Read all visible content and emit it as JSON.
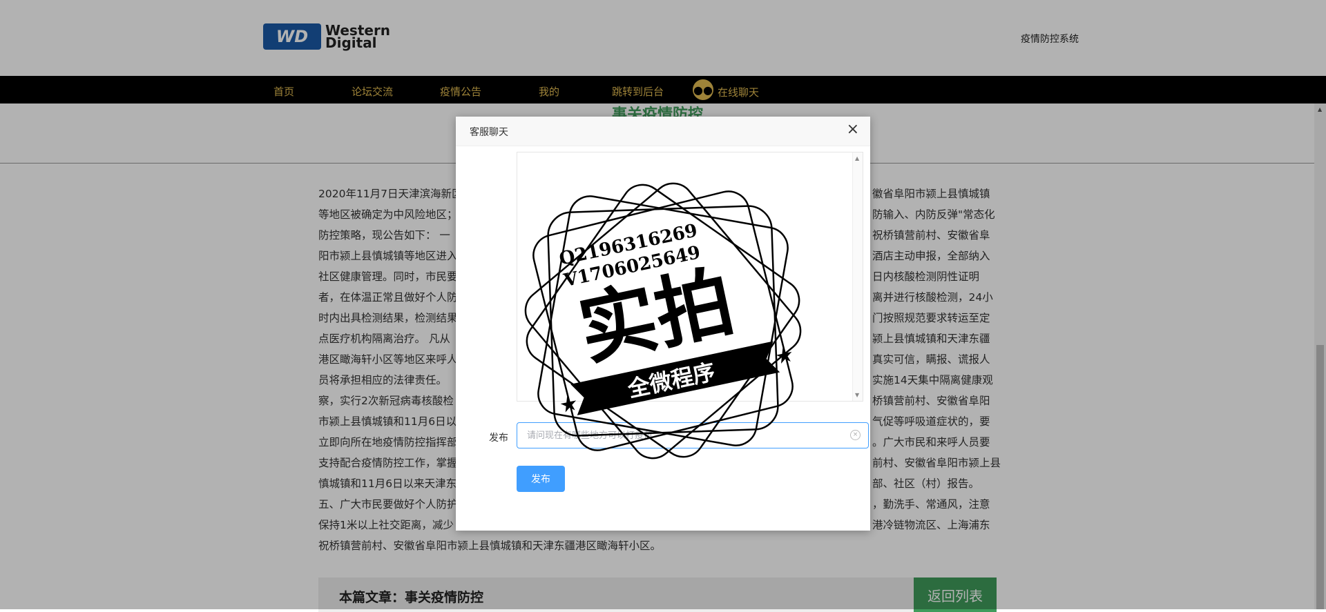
{
  "header": {
    "logo_badge": "WD",
    "logo_line1": "Western",
    "logo_line2": "Digital",
    "system_link": "疫情防控系统"
  },
  "nav": {
    "items": [
      {
        "label": "首页"
      },
      {
        "label": "论坛交流"
      },
      {
        "label": "疫情公告"
      },
      {
        "label": "我的"
      },
      {
        "label": "跳转到后台"
      }
    ],
    "chat_label": "在线聊天"
  },
  "page": {
    "title": "事关疫情防控",
    "article_lines": [
      "2020年11月7日天津滨海新区",
      "等地区被确定为中风险地区；",
      "防控策略，现公告如下： 一",
      "阳市颍上县慎城镇等地区进入",
      "社区健康管理。同时，市民要",
      "者，在体温正常且做好个人防",
      "时内出具检测结果，检测结果",
      "点医疗机构隔离治疗。 凡从",
      "港区瞰海轩小区等地区来呼人",
      "员将承担相应的法律责任。",
      "察，实行2次新冠病毒核酸检",
      "市颍上县慎城镇和11月6日以",
      "立即向所在地疫情防控指挥部",
      "支持配合疫情防控工作，掌握",
      "慎城镇和11月6日以来天津东",
      "五、广大市民要做好个人防护",
      "保持1米以上社交距离，减少",
      "祝桥镇营前村、安徽省阜阳市颍上县慎城镇和天津东疆港区瞰海轩小区。"
    ],
    "article_right": [
      "徽省阜阳市颍上县慎城镇",
      "防输入、内防反弹\"常态化",
      "祝桥镇营前村、安徽省阜",
      "酒店主动申报，全部纳入",
      "日内核酸检测阴性证明",
      "离并进行核酸检测，24小",
      "门按照规范要求转运至定",
      "颍上县慎城镇和天津东疆",
      "真实可信，瞒报、谎报人",
      "实施14天集中隔离健康观",
      "桥镇营前村、安徽省阜阳",
      "气促等呼吸道症状的，要",
      "。广大市民和来呼人员要",
      "前村、安徽省阜阳市颍上县",
      "部、社区（村）报告。",
      "，勤洗手、常通风，注意",
      "港冷链物流区、上海浦东",
      ""
    ],
    "footer_label": "本篇文章：事关疫情防控",
    "back_button": "返回列表"
  },
  "modal": {
    "title": "客服聊天",
    "close_symbol": "×",
    "form_label": "发布",
    "input_placeholder": "请问现在有哪些地方可以打疫苗",
    "input_value": "",
    "submit_label": "发布"
  },
  "watermark": {
    "line1": "Q2196316269",
    "line2": "V1706025649",
    "main_text": "实拍",
    "ribbon_text": "全微程序"
  }
}
